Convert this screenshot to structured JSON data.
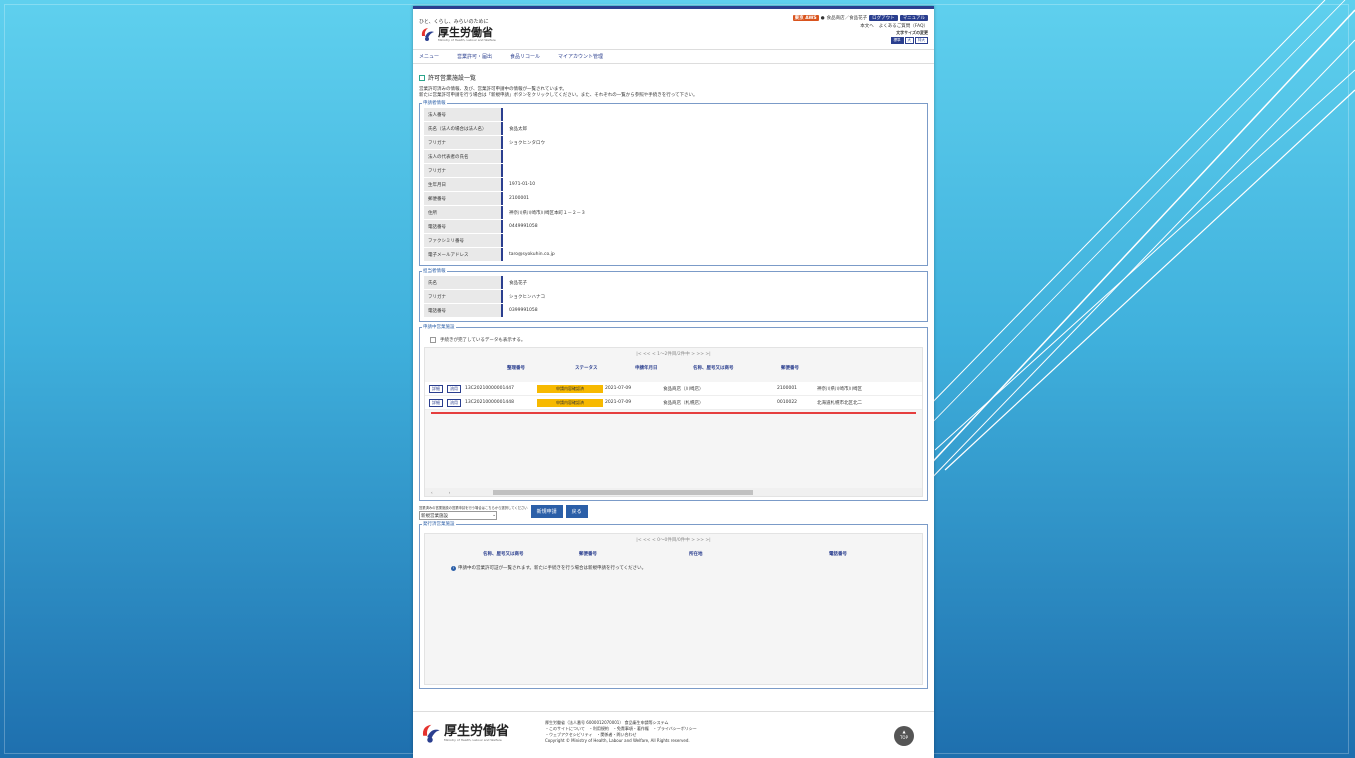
{
  "colors": {
    "brand": "#2b3f8f",
    "accent_status": "#f7b900",
    "env_badge": "#d9541e",
    "link": "#2b5fa8"
  },
  "header": {
    "tagline": "ひと、くらし、みらいのために",
    "logo_jp": "厚生労働省",
    "logo_en": "Ministry of Health, Labour and Welfare",
    "env_badge": "東京 AWS",
    "user": "食品商店／食品花子",
    "logout_label": "ログアウト",
    "manual_label": "マニュアル",
    "links": [
      "本文へ",
      "よくあるご質問（FAQ）"
    ],
    "fontsize_label": "文字サイズの変更",
    "fontsize_options": [
      "標準",
      "大",
      "特大"
    ]
  },
  "nav": {
    "items": [
      "メニュー",
      "営業許可・届出",
      "食品リコール",
      "マイアカウント管理"
    ]
  },
  "main": {
    "title": "許可営業施設一覧",
    "desc1": "営業許可済みの情報、及び、営業許可申請中の情報が一覧されています。",
    "desc2": "新たに営業許可申請を行う場合は「新規申請」ボタンをクリックしてください。また、それぞれの一覧から参照や手続きを行って下さい。"
  },
  "applicant": {
    "legend": "申請者情報",
    "rows": [
      {
        "label": "法人番号",
        "value": ""
      },
      {
        "label": "氏名（法人の場合は法人名）",
        "value": "食品太郎"
      },
      {
        "label": "フリガナ",
        "value": "ショクヒンタロウ"
      },
      {
        "label": "法人の代表者の氏名",
        "value": ""
      },
      {
        "label": "フリガナ",
        "value": ""
      },
      {
        "label": "生年月日",
        "value": "1971-01-10"
      },
      {
        "label": "郵便番号",
        "value": "2100001"
      },
      {
        "label": "住所",
        "value": "神奈川県川崎市川崎区本町１－２－３"
      },
      {
        "label": "電話番号",
        "value": "0449991058"
      },
      {
        "label": "ファクシミリ番号",
        "value": ""
      },
      {
        "label": "電子メールアドレス",
        "value": "taro@syokuhin.co.jp"
      }
    ]
  },
  "contact": {
    "legend": "担当者情報",
    "rows": [
      {
        "label": "氏名",
        "value": "食品花子"
      },
      {
        "label": "フリガナ",
        "value": "ショクヒンハナコ"
      },
      {
        "label": "電話番号",
        "value": "0399991058"
      }
    ]
  },
  "applying": {
    "legend": "申請中営業施設",
    "checkbox_label": "手続きが完了しているデータも表示する。",
    "pager": "|<  <<  <  1～2件目/2件中  >  >>  >|",
    "columns": [
      "整理番号",
      "ステータス",
      "申請年月日",
      "名称、屋号又は商号",
      "郵便番号"
    ],
    "btn_detail": "詳細",
    "btn_reuse": "流用",
    "rows": [
      {
        "no": "13C20210000001447",
        "status": "申請内容確認済",
        "date": "2021-07-09",
        "name": "食品商店（川崎店）",
        "zip": "2100001",
        "addr": "神奈川県川崎市川崎区"
      },
      {
        "no": "13C20210000001448",
        "status": "申請内容確認済",
        "date": "2021-07-09",
        "name": "食品商店（札幌店）",
        "zip": "0010022",
        "addr": "北海道札幌市北区北二"
      }
    ]
  },
  "select_area": {
    "hint": "営業済みの営業施設の営業申請を行う場合はこちらから選択してください",
    "selected": "新規営業施設",
    "new_button": "新規申請",
    "back_button": "戻る"
  },
  "issued": {
    "legend": "発行済営業施設",
    "pager": "|<  <<  <  0～0件目/0件中  >  >>  >|",
    "columns": [
      "名称、屋号又は商号",
      "郵便番号",
      "所在地",
      "電話番号"
    ],
    "info": "申請中の営業許可証が一覧されます。新たに手続きを行う場合は新規申請を行ってください。"
  },
  "footer": {
    "logo_jp": "厚生労働省",
    "logo_en": "Ministry of Health, Labour and Welfare",
    "line1": "厚生労働省（法人番号 6000012070001）   食品衛生申請等システム",
    "line2": "・このサイトについて　・利用規約　・免責事項・著作権　・プライバシーポリシー",
    "line3": "・ウェブアクセシビリティ　・関係者・問い合わせ",
    "copyright": "Copyright © Ministry of Health, Labour and Welfare, All Rights reserved.",
    "top_label": "TOP"
  }
}
